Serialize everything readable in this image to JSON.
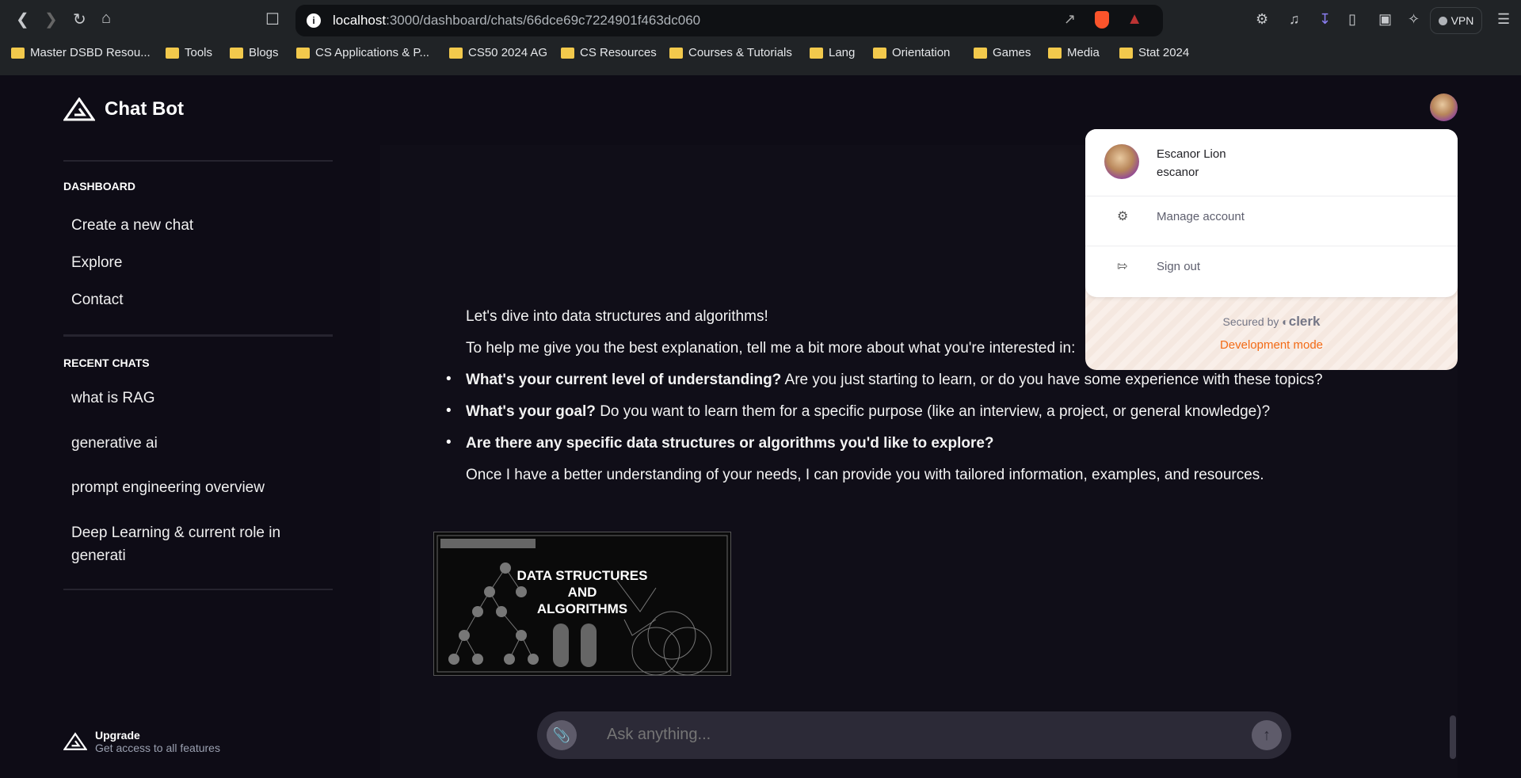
{
  "browser": {
    "url_host": "localhost",
    "url_path": ":3000/dashboard/chats/66dce69c7224901f463dc060",
    "vpn_label": "VPN",
    "bookmarks": [
      "Master DSBD Resou...",
      "Tools",
      "Blogs",
      "CS Applications & P...",
      "CS50 2024 AG",
      "CS Resources",
      "Courses & Tutorials",
      "Lang",
      "Orientation",
      "Games",
      "Media",
      "Stat 2024"
    ]
  },
  "sidebar": {
    "app_name": "Chat Bot",
    "dashboard_heading": "DASHBOARD",
    "dashboard_items": [
      "Create a new chat",
      "Explore",
      "Contact"
    ],
    "recent_heading": "RECENT CHATS",
    "recent_chats": [
      "what is RAG",
      "generative ai",
      "prompt engineering overview",
      "Deep Learning & current role in generati"
    ],
    "upgrade_title": "Upgrade",
    "upgrade_subtitle": "Get access to all features"
  },
  "chat": {
    "intro": "Let's dive into data structures and algorithms!",
    "prompt": "To help me give you the best explanation, tell me a bit more about what you're interested in:",
    "bullets": [
      {
        "bold": "What's your current level of understanding?",
        "rest": " Are you just starting to learn, or do you have some experience with these topics?"
      },
      {
        "bold": "What's your goal?",
        "rest": " Do you want to learn them for a specific purpose (like an interview, a project, or general knowledge)?"
      },
      {
        "bold": "Are there any specific data structures or algorithms you'd like to explore?",
        "rest": ""
      }
    ],
    "closing": "Once I have a better understanding of your needs, I can provide you with tailored information, examples, and resources.",
    "image_title_1": "DATA STRUCTURES",
    "image_title_2": "AND",
    "image_title_3": "ALGORITHMS"
  },
  "input": {
    "placeholder": "Ask anything..."
  },
  "user_menu": {
    "name": "Escanor Lion",
    "username": "escanor",
    "manage": "Manage account",
    "signout": "Sign out",
    "secured_by": "Secured by",
    "clerk": "clerk",
    "dev_mode": "Development mode"
  }
}
